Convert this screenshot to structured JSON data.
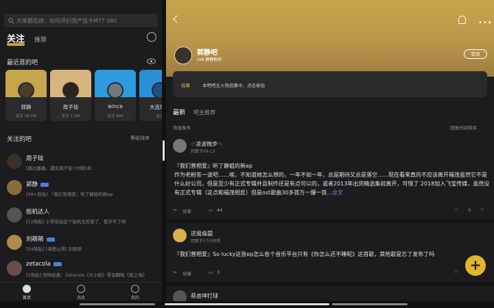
{
  "left": {
    "search_placeholder": "大家都在搜：如何评价国产显卡MTT S80",
    "tabs": {
      "active": "关注",
      "other": "推荐"
    },
    "recent_title": "最近逛的吧",
    "recent": [
      {
        "name": "郭静",
        "followers": "关注 28.2W"
      },
      {
        "name": "周子琰",
        "followers": "关注 2.2W"
      },
      {
        "name": "wince",
        "followers": "关注 903"
      },
      {
        "name": "大连理工",
        "followers": "关注"
      }
    ],
    "followed_title": "关注的吧",
    "sort_label": "等级排序",
    "followed": [
      {
        "name": "周子琰",
        "desc": "[跳过番番。遇见周子琰] 时隔5年"
      },
      {
        "name": "郭静",
        "desc": "[99+热贴] 『我们曾相爱』听了静姐的新ep"
      },
      {
        "name": "街机达人",
        "desc": "[12热贴] 小哥有玩这个街机太厉害了，我学不了呀"
      },
      {
        "name": "刘萌萌",
        "desc": "[54热贴] [海警山哥] 刘萌萌"
      },
      {
        "name": "zetacola",
        "desc": "[5热贴] 回味经典：Zetacola《大小姐》哥音翻唱《星之海》"
      }
    ],
    "nav": [
      {
        "label": "首页"
      },
      {
        "label": "消息"
      },
      {
        "label": "我的"
      }
    ]
  },
  "right": {
    "bar_name": "郭静吧",
    "bar_level": "LV8  静静粉听",
    "checkin": "签到",
    "notice_tag": "招募",
    "notice_text": "本吧吧主火热招募中，点击参加",
    "tabs": {
      "active": "最新",
      "other": "吧主推荐"
    },
    "filter": "筛选条件",
    "sort": "回复时间排序",
    "posts": [
      {
        "author": "☞凌波微步☜",
        "time": "回复于09-13",
        "text": "『我们曾相爱』听了静姐的新ep",
        "text2": "作为老粉答一波吧……唉，不知道她怎么想的，一年不如一年，总是期待又总是落空……现在看来真的不应该离开福茂虽然它不是什么好公司，但是至少有正式专辑并且制作还是有点可以的，或者2013年出完精选集就离开，可惜了 2018加入飞宝传媒，虽然没有正式专辑（这点和福茂相反）但是ost歌曲30多首万一爆一首...",
        "more": "全文",
        "share": "分享",
        "comments": "44",
        "likes": "0"
      },
      {
        "author": "逆風倫囍",
        "time": "回复于17小时前",
        "text": "『我们曾相爱』So lucky这张ep怎么各个音乐平台只有《你怎么还不睡呢》这首歌，其他歌是忘了发布了吗",
        "share": "分享",
        "comments": "3"
      },
      {
        "author": "蔡虚坤打球"
      }
    ],
    "fab": "+"
  },
  "colors": {
    "accent": "#e5c32c",
    "header": "#c7a54d",
    "link": "#5b8def"
  }
}
